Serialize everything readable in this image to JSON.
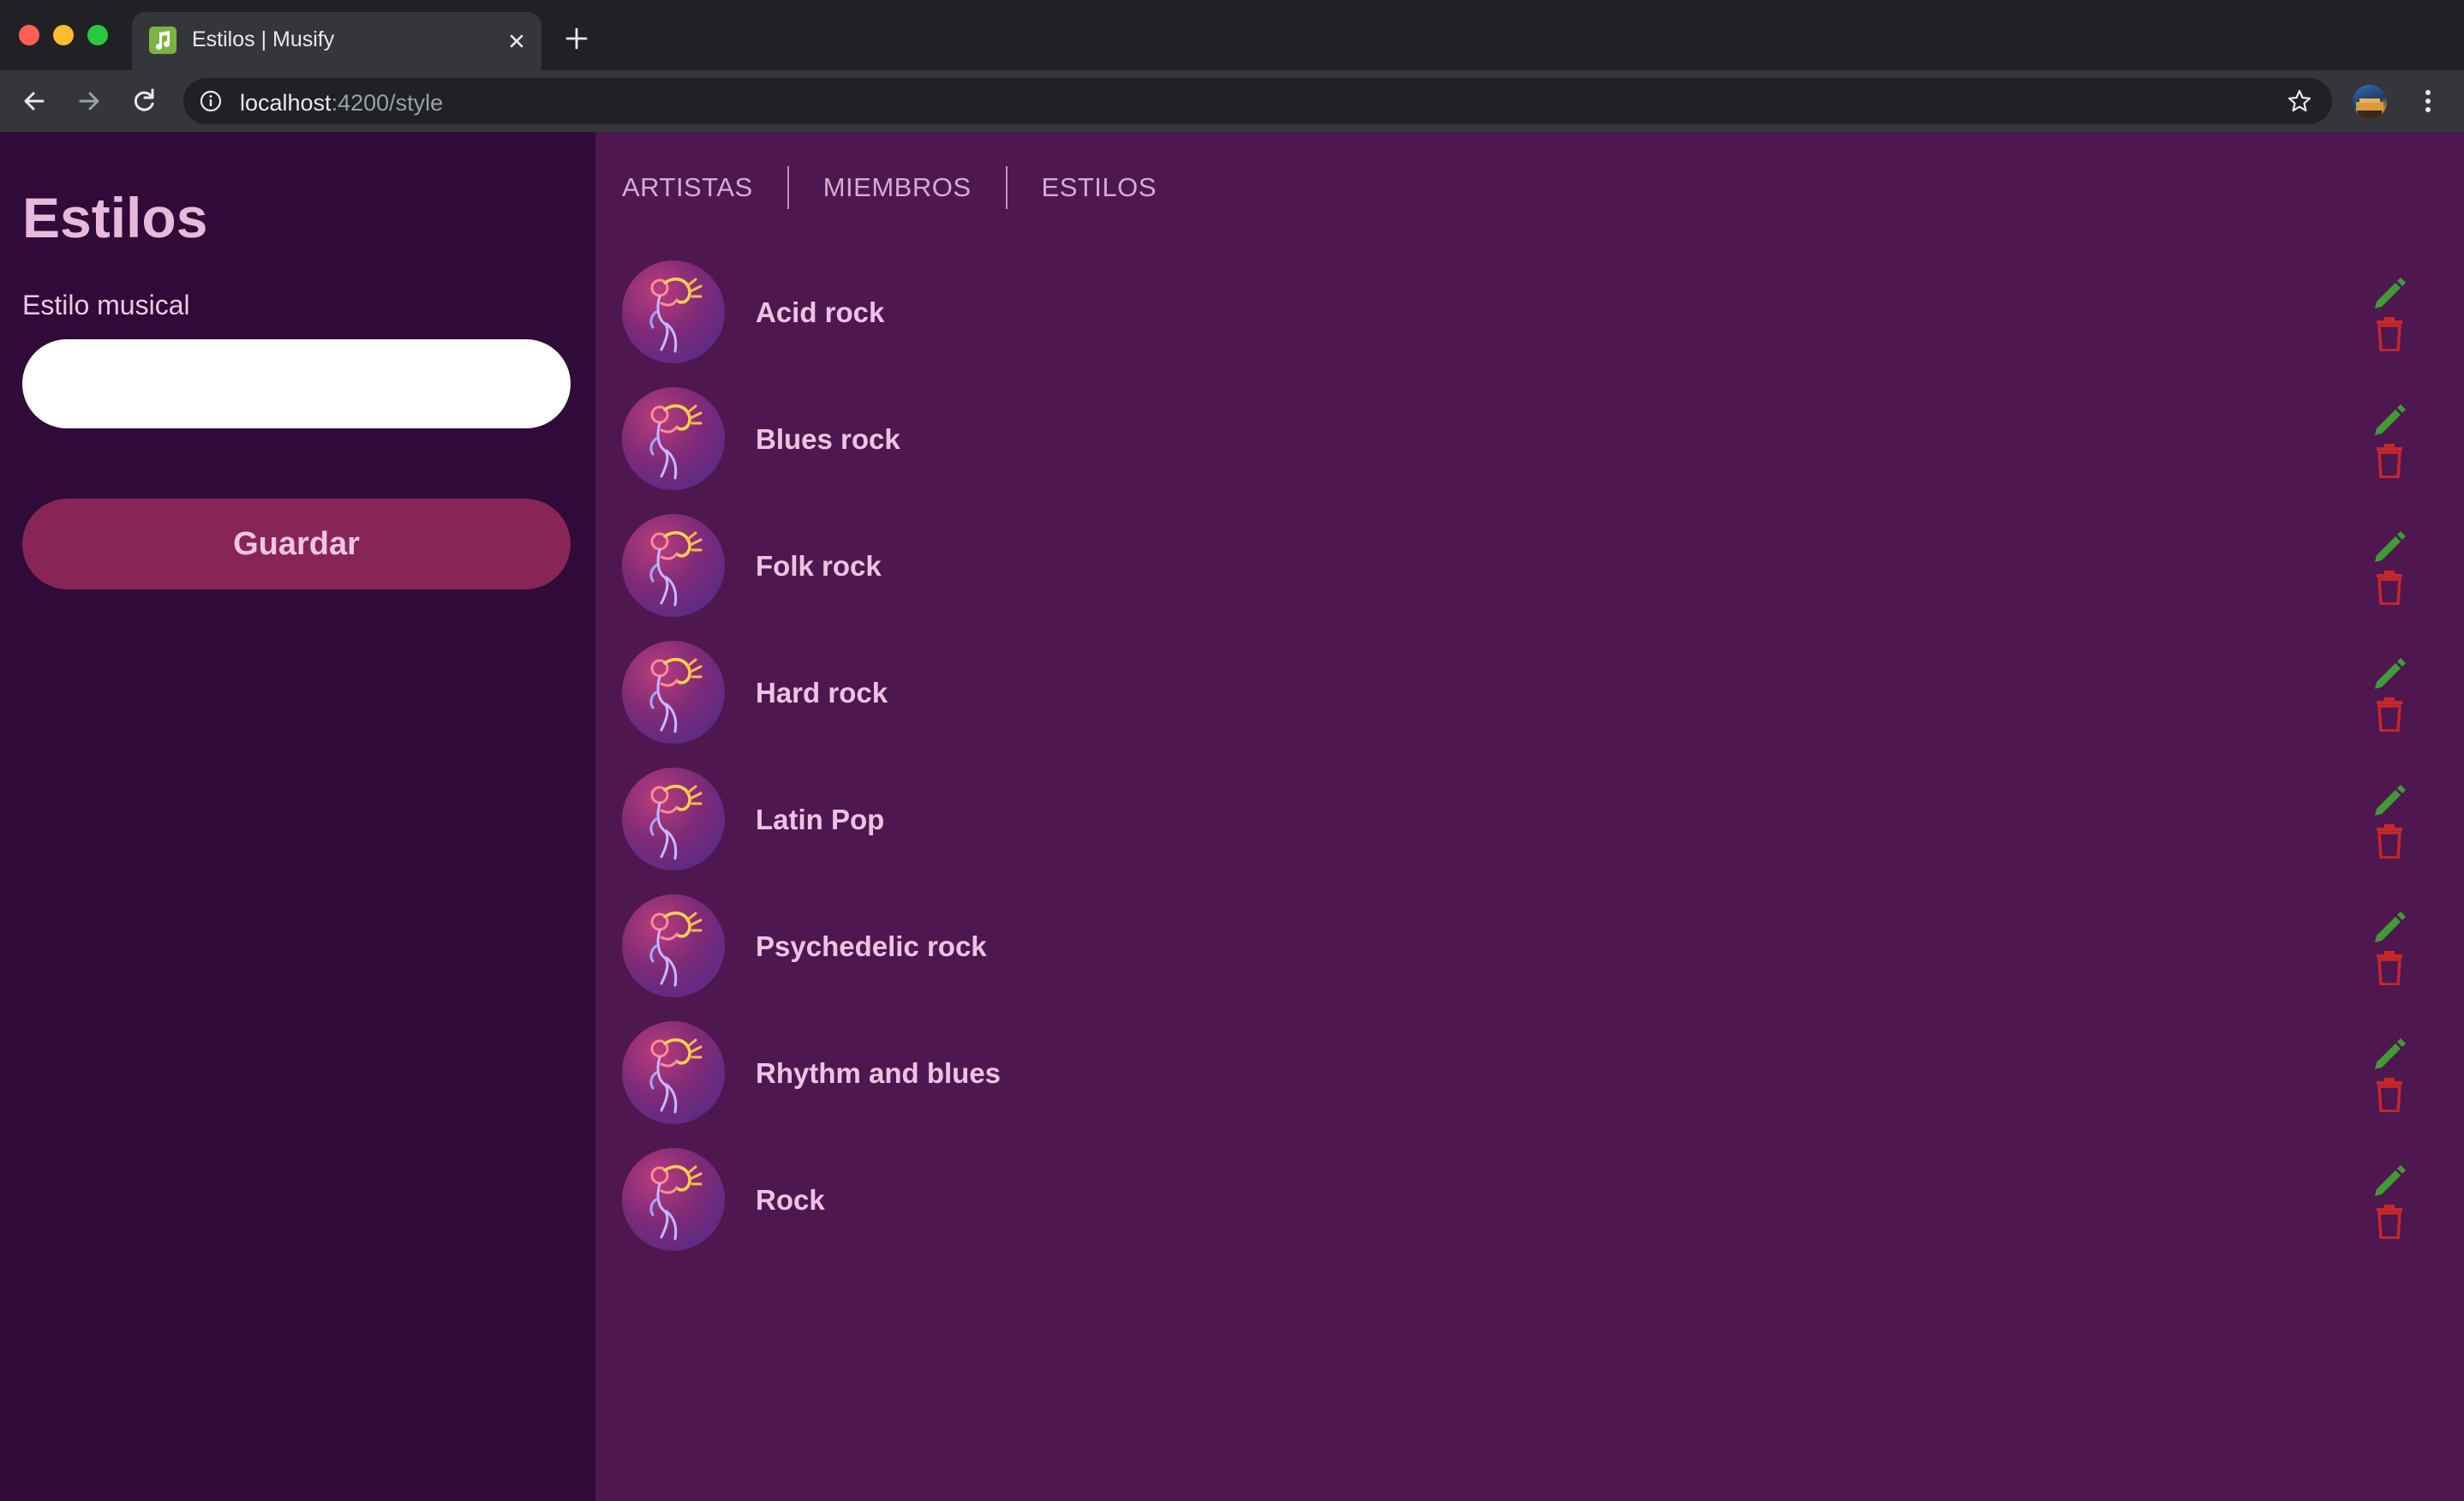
{
  "browser": {
    "tab_title": "Estilos | Musify",
    "url_host": "localhost",
    "url_path": ":4200/style"
  },
  "sidebar": {
    "title": "Estilos",
    "field_label": "Estilo musical",
    "input_value": "",
    "save_label": "Guardar"
  },
  "nav": {
    "items": [
      {
        "label": "ARTISTAS"
      },
      {
        "label": "MIEMBROS"
      },
      {
        "label": "ESTILOS"
      }
    ]
  },
  "styles": [
    {
      "name": "Acid rock"
    },
    {
      "name": "Blues rock"
    },
    {
      "name": "Folk rock"
    },
    {
      "name": "Hard rock"
    },
    {
      "name": "Latin Pop"
    },
    {
      "name": "Psychedelic rock"
    },
    {
      "name": "Rhythm and blues"
    },
    {
      "name": "Rock"
    }
  ],
  "colors": {
    "sidebar_bg": "#300a38",
    "main_bg": "#4f1750",
    "accent_button": "#862556",
    "edit_icon": "#3f9c35",
    "delete_icon": "#c62828"
  },
  "icons": {
    "row_avatar": "saxophone-player-icon",
    "edit": "pencil-icon",
    "delete": "trash-icon"
  }
}
